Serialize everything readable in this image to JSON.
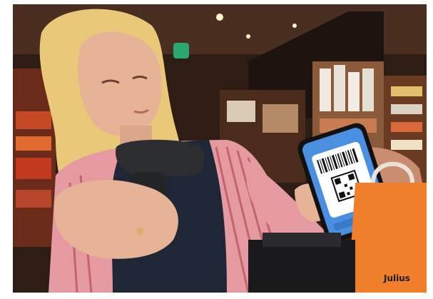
{
  "photo": {
    "description_free": true,
    "colors": {
      "ceiling": "#3b2418",
      "shelf_warm": "#c0522b",
      "hair": "#e9c87a",
      "skin": "#e7b397",
      "shirt_stripe": "#d77d82",
      "vest": "#1f2736",
      "scanner": "#2b2d31",
      "phone_screen": "#4a8fe0",
      "bag_orange": "#ef7f2a"
    }
  },
  "bag": {
    "brand_text": "Julius"
  }
}
